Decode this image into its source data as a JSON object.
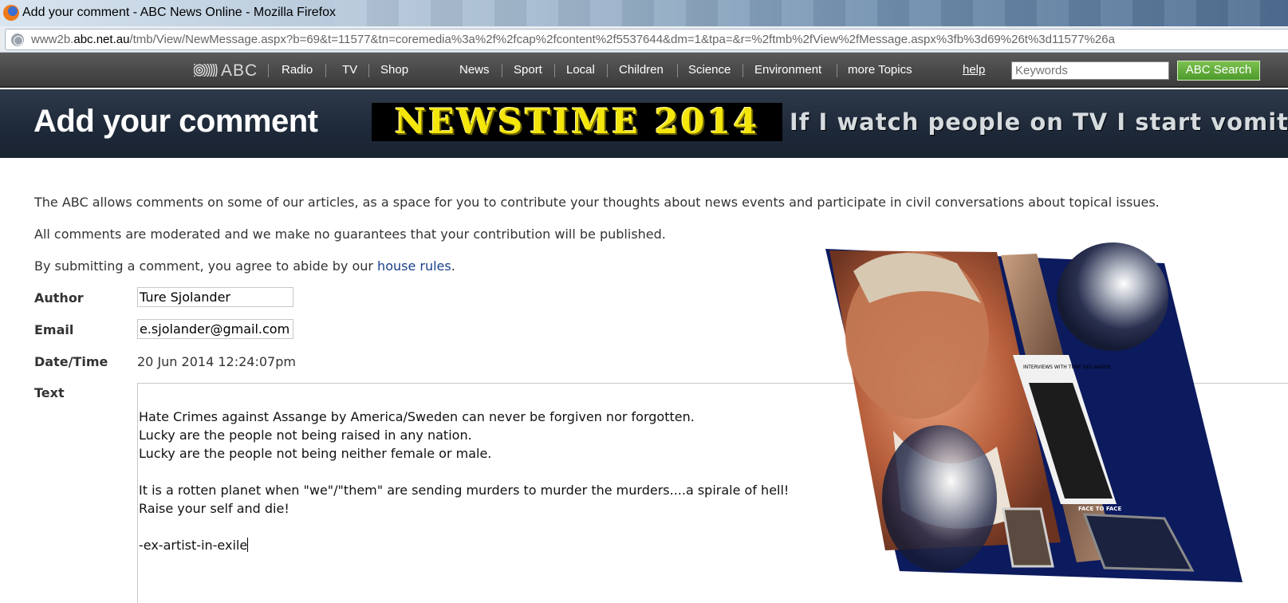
{
  "window": {
    "title": "Add your comment - ABC News Online - Mozilla Firefox"
  },
  "address": {
    "url_prefix": "www2b.",
    "url_domain": "abc.net.au",
    "url_rest": "/tmb/View/NewMessage.aspx?b=69&t=11577&tn=coremedia%3a%2f%2fcap%2fcontent%2f5537644&dm=1&tpa=&r=%2ftmb%2fView%2fMessage.aspx%3fb%3d69%26t%3d11577%26a"
  },
  "nav": {
    "logo": "ABC",
    "items": [
      "Radio",
      "TV",
      "Shop",
      "News",
      "Sport",
      "Local",
      "Children",
      "Science",
      "Environment",
      "more Topics"
    ],
    "help": "help",
    "search_placeholder": "Keywords",
    "search_button": "ABC Search"
  },
  "banner": {
    "title": "Add your comment",
    "newstime": "NEWSTIME 2014",
    "slogan": "If I watch people on TV I start vomit"
  },
  "intro": {
    "p1": "The ABC allows comments on some of our articles, as a space for you to contribute your thoughts about news events and participate in civil conversations about topical issues.",
    "p2": "All comments are moderated and we make no guarantees that your contribution will be published.",
    "p3_before": "By submitting a comment, you agree to abide by our ",
    "p3_link": "house rules",
    "p3_after": "."
  },
  "form": {
    "author_label": "Author",
    "author_value": "Ture Sjolander",
    "email_label": "Email",
    "email_value": "e.sjolander@gmail.com",
    "datetime_label": "Date/Time",
    "datetime_value": "20 Jun 2014 12:24:07pm",
    "text_label": "Text",
    "text_lines": [
      "Hate Crimes against Assange by America/Sweden can never be forgiven nor forgotten.",
      "Lucky are the people not being raised in any nation.",
      "Lucky are the people not being neither female or male.",
      "It is a rotten planet when \"we\"/\"them\" are sending murders to murder the murders....a spirale of hell!",
      "Raise your self and die!",
      "-ex-artist-in-exile"
    ]
  },
  "collage": {
    "caption_top": "INTERVIEWS WITH TURE SJOLANDER",
    "caption_bottom": "FACE TO FACE"
  }
}
